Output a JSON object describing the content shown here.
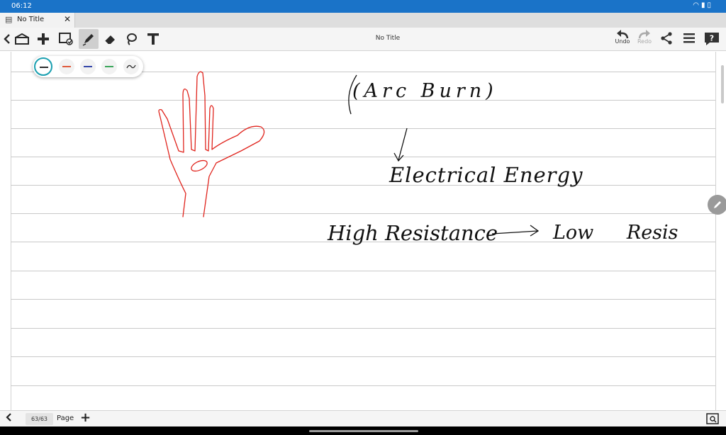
{
  "status": {
    "time": "06:12",
    "icons": [
      "wifi-icon",
      "signal-icon",
      "battery-icon"
    ]
  },
  "tab": {
    "title": "No Title",
    "close_glyph": "✕"
  },
  "toolbar": {
    "left_tools": [
      "back-icon",
      "notebook-icon",
      "add-icon",
      "screen-capture-icon",
      "pen-icon",
      "eraser-icon",
      "lasso-icon",
      "text-icon"
    ],
    "active_tool": "pen-icon",
    "title": "No Title",
    "undo_label": "Undo",
    "redo_label": "Redo"
  },
  "palette": {
    "colors": [
      "#2b2b2b",
      "#e05a3c",
      "#3346a8",
      "#3aa55a",
      "#2b2b2b"
    ],
    "selected_index": 0,
    "accent": "#1a9fb0"
  },
  "ink": {
    "handwriting_text": [
      "(Arc Burn)",
      "Electrical Energy",
      "High Resistance",
      "Low Resis"
    ],
    "hand_color": "#e0241d",
    "pen_color": "#111111"
  },
  "footer": {
    "page_count": "63/63",
    "page_label": "Page"
  },
  "colors": {
    "status_bar": "#1a73c8",
    "toolbar_bg": "#f5f5f5",
    "rule_line": "#c9c9c9"
  }
}
